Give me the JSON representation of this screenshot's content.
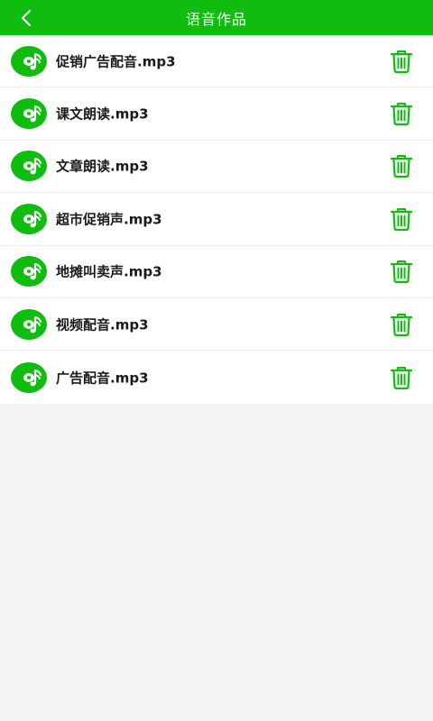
{
  "header": {
    "title": "语音作品",
    "back_icon": "chevron-left-icon",
    "background": "#0fbd0f"
  },
  "items": [
    {
      "name": "促销广告配音.mp3"
    },
    {
      "name": "课文朗读.mp3"
    },
    {
      "name": "文章朗读.mp3"
    },
    {
      "name": "超市促销声.mp3"
    },
    {
      "name": "地摊叫卖声.mp3"
    },
    {
      "name": "视频配音.mp3"
    },
    {
      "name": "广告配音.mp3"
    }
  ],
  "icons": {
    "file_icon": "music-disc-icon",
    "delete_icon": "trash-icon"
  },
  "colors": {
    "accent": "#0fbd0f",
    "row_bg": "#ffffff",
    "page_bg": "#f3f3f3",
    "text": "#1a1a1a"
  }
}
